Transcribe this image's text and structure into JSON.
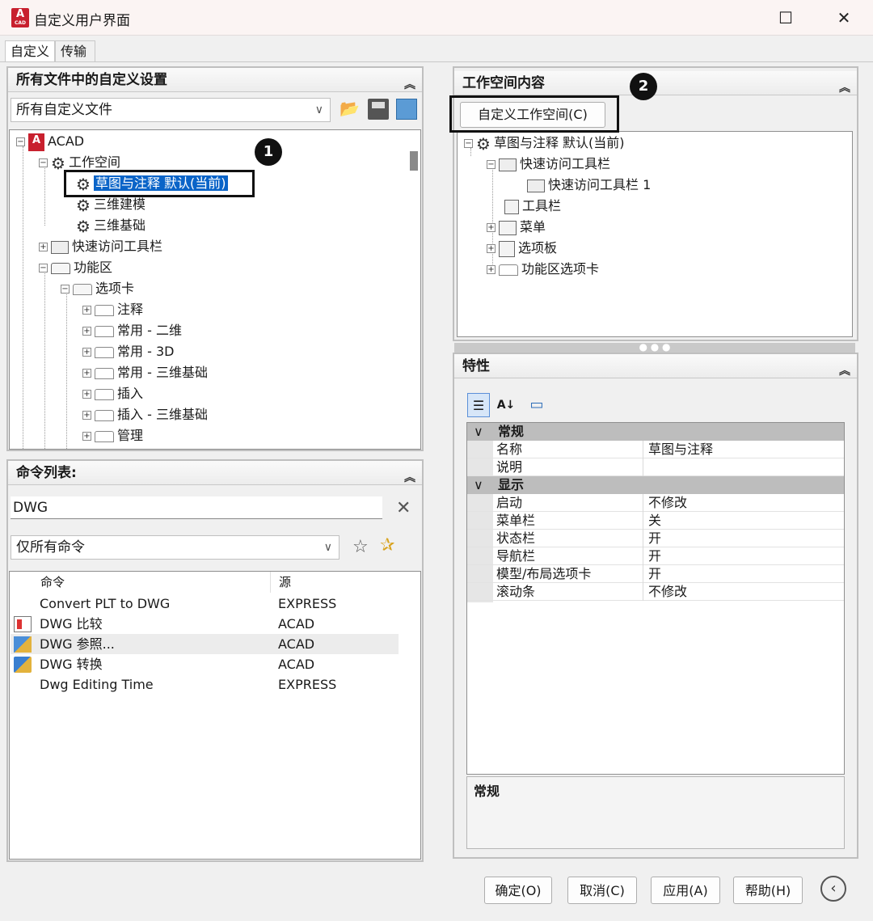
{
  "window": {
    "title": "自定义用户界面",
    "icon_label": "A",
    "icon_sub": "CAD",
    "maximize": "☐",
    "close": "✕"
  },
  "tabs": [
    {
      "label": "自定义"
    },
    {
      "label": "传输"
    }
  ],
  "customizations_panel": {
    "title": "所有文件中的自定义设置",
    "dropdown_value": "所有自定义文件",
    "tree": [
      {
        "label": "ACAD"
      },
      {
        "label": "工作空间"
      },
      {
        "label": "草图与注释 默认(当前)"
      },
      {
        "label": "三维建模"
      },
      {
        "label": "三维基础"
      },
      {
        "label": "快速访问工具栏"
      },
      {
        "label": "功能区"
      },
      {
        "label": "选项卡"
      },
      {
        "label": "注释"
      },
      {
        "label": "常用 - 二维"
      },
      {
        "label": "常用 - 3D"
      },
      {
        "label": "常用 - 三维基础"
      },
      {
        "label": "插入"
      },
      {
        "label": "插入 - 三维基础"
      },
      {
        "label": "管理"
      }
    ]
  },
  "command_list_panel": {
    "title": "命令列表:",
    "search_value": "DWG",
    "filter_value": "仅所有命令",
    "columns": {
      "command": "命令",
      "source": "源"
    },
    "rows": [
      {
        "command": "Convert PLT to DWG",
        "source": "EXPRESS"
      },
      {
        "command": "DWG 比较",
        "source": "ACAD"
      },
      {
        "command": "DWG 参照...",
        "source": "ACAD"
      },
      {
        "command": "DWG 转换",
        "source": "ACAD"
      },
      {
        "command": "Dwg Editing Time",
        "source": "EXPRESS"
      }
    ]
  },
  "workspace_panel": {
    "title": "工作空间内容",
    "customize_button": "自定义工作空间(C)",
    "tree": [
      {
        "label": "草图与注释 默认(当前)"
      },
      {
        "label": "快速访问工具栏"
      },
      {
        "label": "快速访问工具栏 1"
      },
      {
        "label": "工具栏"
      },
      {
        "label": "菜单"
      },
      {
        "label": "选项板"
      },
      {
        "label": "功能区选项卡"
      }
    ]
  },
  "properties_panel": {
    "title": "特性",
    "categories": [
      {
        "name": "常规",
        "rows": [
          {
            "key": "名称",
            "value": "草图与注释"
          },
          {
            "key": "说明",
            "value": ""
          }
        ]
      },
      {
        "name": "显示",
        "rows": [
          {
            "key": "启动",
            "value": "不修改"
          },
          {
            "key": "菜单栏",
            "value": "关"
          },
          {
            "key": "状态栏",
            "value": "开"
          },
          {
            "key": "导航栏",
            "value": "开"
          },
          {
            "key": "模型/布局选项卡",
            "value": "开"
          },
          {
            "key": "滚动条",
            "value": "不修改"
          }
        ]
      }
    ],
    "description_title": "常规"
  },
  "callouts": {
    "one": "1",
    "two": "2"
  },
  "buttons": {
    "ok": "确定(O)",
    "cancel": "取消(C)",
    "apply": "应用(A)",
    "help": "帮助(H)"
  },
  "colors": {
    "selection": "#0a64c8",
    "icon_red": "#c8202e",
    "callout": "#111111"
  }
}
